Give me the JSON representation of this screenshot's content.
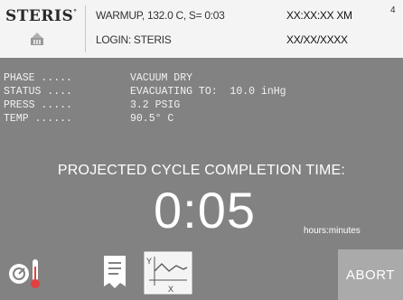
{
  "header": {
    "logo_text": "STERIS",
    "logo_tm": "°",
    "status_line": "WARMUP, 132.0 C, S= 0:03",
    "login_line": "LOGIN: STERIS",
    "time": "XX:XX:XX XM",
    "date": "XX/XX/XXXX",
    "corner_number": "4"
  },
  "info": {
    "phase": {
      "label": "PHASE .....",
      "value": "VACUUM DRY"
    },
    "status": {
      "label": "STATUS ....",
      "value": "EVACUATING TO:  10.0 inHg"
    },
    "press": {
      "label": "PRESS .....",
      "value": "3.2",
      "unit": "PSIG"
    },
    "temp": {
      "label": "TEMP ......",
      "value": "90.5° C"
    }
  },
  "cycle": {
    "projected_label": "PROJECTED CYCLE COMPLETION TIME:",
    "time": "0:05",
    "units": "hours:minutes"
  },
  "toolbar": {
    "graph_y_label": "Y",
    "graph_x_label": "X",
    "abort_label": "ABORT"
  },
  "colors": {
    "background": "#828282",
    "header_background": "#f4f4f4",
    "abort_background": "#aaaaaa"
  },
  "icons": [
    "steris-emblem-icon",
    "gauge-thermometer-icon",
    "document-printout-icon",
    "graph-icon"
  ]
}
